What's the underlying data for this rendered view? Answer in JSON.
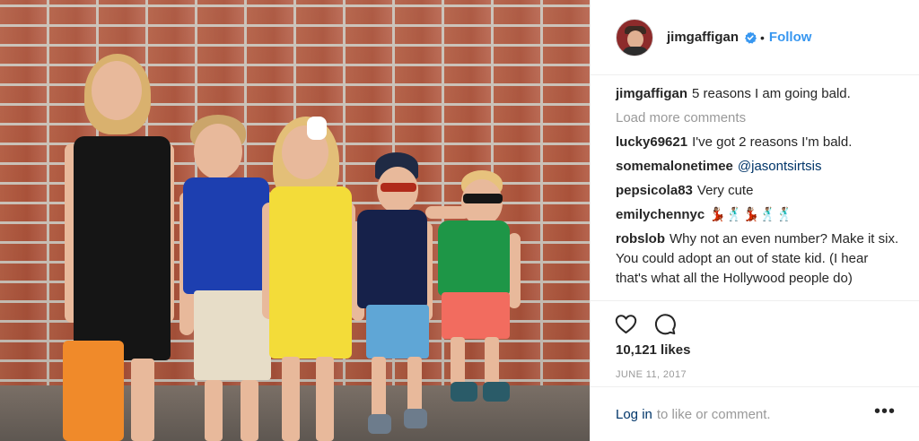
{
  "photo": {
    "alt_icon": "photo-of-children"
  },
  "header": {
    "username": "jimgaffigan",
    "verified_icon": "verified-badge-icon",
    "separator": "•",
    "follow_label": "Follow",
    "accent_color": "#3897f0"
  },
  "caption": {
    "username": "jimgaffigan",
    "text": "5 reasons I am going bald."
  },
  "load_more": "Load more comments",
  "comments": [
    {
      "username": "lucky69621",
      "text": "I've got 2 reasons I'm bald."
    },
    {
      "username": "somemalonetimee",
      "text": "@jasontsirtsis"
    },
    {
      "username": "pepsicola83",
      "text": "Very cute"
    },
    {
      "username": "emilychennyc",
      "text": "💃🏽🕺🏽💃🏽🕺🏽🕺🏽"
    },
    {
      "username": "robslob",
      "text": "Why not an even number? Make it six. You could adopt an out of state kid. (I hear that's what all the Hollywood people do)"
    }
  ],
  "actions": {
    "like_icon": "heart-icon",
    "comment_icon": "comment-bubble-icon"
  },
  "likes": "10,121 likes",
  "date": "JUNE 11, 2017",
  "footer": {
    "login_label": "Log in",
    "login_suffix": "to like or comment.",
    "more_label": "•••"
  }
}
